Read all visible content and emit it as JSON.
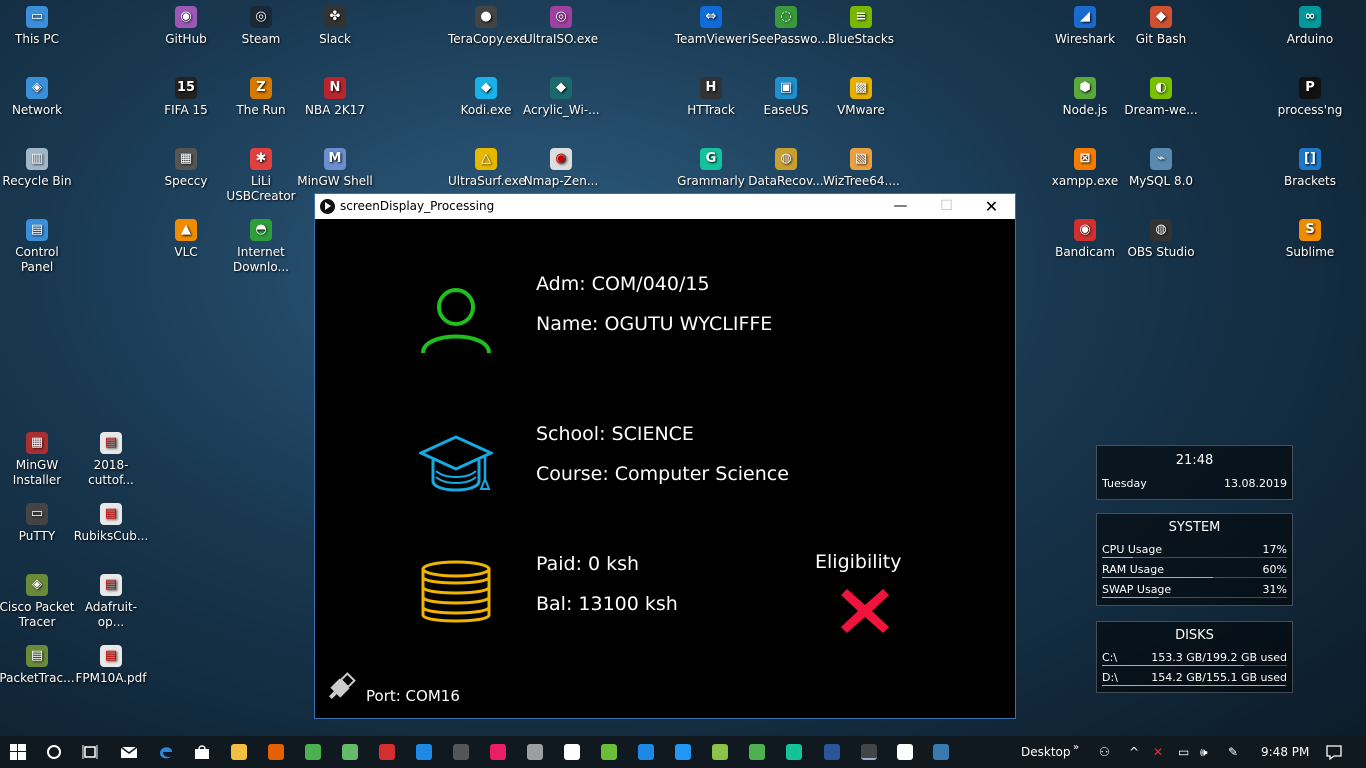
{
  "desktop_icons": [
    {
      "label": "This PC",
      "color": "#3b8fd9",
      "glyph": "▭"
    },
    {
      "label": "Network",
      "color": "#3b8fd9",
      "glyph": "◈"
    },
    {
      "label": "Recycle Bin",
      "color": "#9fb7c8",
      "glyph": "▥"
    },
    {
      "label": "Control Panel",
      "color": "#3b8fd9",
      "glyph": "▤"
    },
    {
      "label": "GitHub",
      "color": "#9b59b6",
      "glyph": "◉"
    },
    {
      "label": "FIFA 15",
      "color": "#222",
      "glyph": "15"
    },
    {
      "label": "Speccy",
      "color": "#555",
      "glyph": "▦"
    },
    {
      "label": "VLC",
      "color": "#f08c00",
      "glyph": "▲"
    },
    {
      "label": "Steam",
      "color": "#1b2838",
      "glyph": "◎"
    },
    {
      "label": "The Run",
      "color": "#d47a00",
      "glyph": "Z"
    },
    {
      "label": "LiLi USBCreator",
      "color": "#e04040",
      "glyph": "✱"
    },
    {
      "label": "Internet Downlo...",
      "color": "#2d9e3a",
      "glyph": "◓"
    },
    {
      "label": "Slack",
      "color": "#333",
      "glyph": "✤"
    },
    {
      "label": "NBA 2K17",
      "color": "#b8252d",
      "glyph": "N"
    },
    {
      "label": "MinGW Shell",
      "color": "#6a8fd0",
      "glyph": "M"
    },
    {
      "label": "TeraCopy.exe",
      "color": "#444",
      "glyph": "●"
    },
    {
      "label": "Kodi.exe",
      "color": "#17b2e8",
      "glyph": "◆"
    },
    {
      "label": "UltraSurf.exe",
      "color": "#e6b800",
      "glyph": "△"
    },
    {
      "label": "UltraISO.exe",
      "color": "#a040a0",
      "glyph": "◎"
    },
    {
      "label": "Acrylic_Wi-...",
      "color": "#1a6a6a",
      "glyph": "◆"
    },
    {
      "label": "Nmap-Zen...",
      "color": "#ddd",
      "glyph": "◉"
    },
    {
      "label": "TeamViewer",
      "color": "#0e6bd8",
      "glyph": "⇔"
    },
    {
      "label": "HTTrack",
      "color": "#333",
      "glyph": "H"
    },
    {
      "label": "Grammarly",
      "color": "#15c39a",
      "glyph": "G"
    },
    {
      "label": "iSeePasswo...",
      "color": "#3a9a3a",
      "glyph": "◌"
    },
    {
      "label": "EaseUS",
      "color": "#1e90d0",
      "glyph": "▣"
    },
    {
      "label": "DataRecov...",
      "color": "#c9a030",
      "glyph": "◍"
    },
    {
      "label": "BlueStacks",
      "color": "#7ab800",
      "glyph": "≡"
    },
    {
      "label": "VMware",
      "color": "#e8b000",
      "glyph": "▩"
    },
    {
      "label": "WizTree64....",
      "color": "#e8a040",
      "glyph": "▧"
    },
    {
      "label": "Wireshark",
      "color": "#1a6ad0",
      "glyph": "◢"
    },
    {
      "label": "Node.js",
      "color": "#5aa83a",
      "glyph": "⬢"
    },
    {
      "label": "xampp.exe",
      "color": "#f57c00",
      "glyph": "⊠"
    },
    {
      "label": "Bandicam",
      "color": "#d03030",
      "glyph": "◉"
    },
    {
      "label": "Git Bash",
      "color": "#d05030",
      "glyph": "◆"
    },
    {
      "label": "Dream-we...",
      "color": "#7ac000",
      "glyph": "◐"
    },
    {
      "label": "MySQL 8.0",
      "color": "#5a8ab0",
      "glyph": "⌁"
    },
    {
      "label": "OBS Studio",
      "color": "#333",
      "glyph": "◍"
    },
    {
      "label": "Arduino",
      "color": "#00979d",
      "glyph": "∞"
    },
    {
      "label": "process'ng",
      "color": "#111",
      "glyph": "P"
    },
    {
      "label": "Brackets",
      "color": "#1e78c8",
      "glyph": "[]"
    },
    {
      "label": "Sublime",
      "color": "#f08c00",
      "glyph": "S"
    },
    {
      "label": "MinGW Installer",
      "color": "#aa3030",
      "glyph": "▦"
    },
    {
      "label": "2018-cuttof...",
      "color": "#e8e8e8",
      "glyph": "▤"
    },
    {
      "label": "PuTTY",
      "color": "#444",
      "glyph": "▭"
    },
    {
      "label": "RubiksCub...",
      "color": "#e8e8e8",
      "glyph": "▤"
    },
    {
      "label": "Cisco Packet Tracer",
      "color": "#6a8a3a",
      "glyph": "◈"
    },
    {
      "label": "Adafruit-op...",
      "color": "#e8e8e8",
      "glyph": "▤"
    },
    {
      "label": "PacketTrac...",
      "color": "#6a8a3a",
      "glyph": "▤"
    },
    {
      "label": "FPM10A.pdf",
      "color": "#e8e8e8",
      "glyph": "▤"
    }
  ],
  "window": {
    "title": "screenDisplay_Processing",
    "minimize": "—",
    "maximize": "☐",
    "close": "✕"
  },
  "student": {
    "adm": "Adm: COM/040/15",
    "name": "Name: OGUTU WYCLIFFE",
    "school": "School: SCIENCE",
    "course": "Course: Computer Science",
    "paid": "Paid: 0 ksh",
    "bal": "Bal: 13100 ksh",
    "eligibility_label": "Eligibility",
    "eligible": false,
    "port": "Port: COM16"
  },
  "colors": {
    "person_icon": "#1fbf1f",
    "cap_icon": "#18a9e0",
    "coins_icon": "#f0b400",
    "cross": "#f0143c",
    "usb_icon": "#cccccc"
  },
  "clock_widget": {
    "time": "21:48",
    "day": "Tuesday",
    "date": "13.08.2019"
  },
  "system_widget": {
    "title": "SYSTEM",
    "rows": [
      {
        "label": "CPU Usage",
        "value": "17%",
        "level": 0.17
      },
      {
        "label": "RAM Usage",
        "value": "60%",
        "level": 0.6
      },
      {
        "label": "SWAP Usage",
        "value": "31%",
        "level": 0.31
      }
    ]
  },
  "disks_widget": {
    "title": "DISKS",
    "rows": [
      {
        "label": "C:\\",
        "value": "153.3 GB/199.2 GB used",
        "level": 0.77
      },
      {
        "label": "D:\\",
        "value": "154.2 GB/155.1 GB used",
        "level": 0.99
      }
    ]
  },
  "taskbar": {
    "desktop_label": "Desktop",
    "time": "9:48 PM",
    "apps": [
      "file-explorer",
      "firefox",
      "chrome",
      "atom",
      "winrar",
      "virtualbox",
      "vpn",
      "intellij",
      "anydroid",
      "inkscape",
      "utorrent",
      "photos",
      "vscode",
      "android-studio",
      "keep",
      "grammarly",
      "word",
      "processing",
      "processing-sketch",
      "wireshark"
    ]
  }
}
